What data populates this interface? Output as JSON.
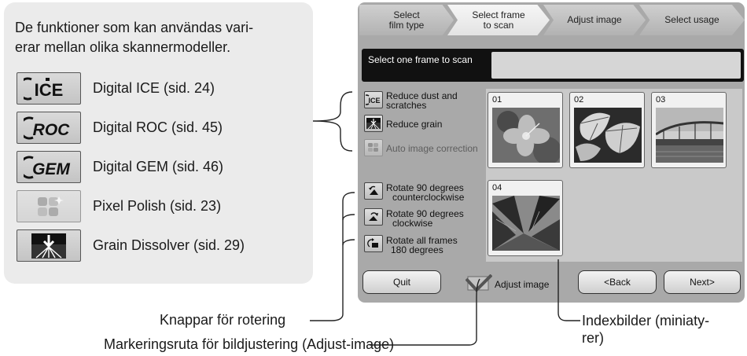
{
  "info_panel": {
    "intro": "De funktioner som kan användas vari-erar mellan olika skannermodeller.",
    "intro_line1": "De funktioner som kan användas vari-",
    "intro_line2": "erar mellan olika skannermodeller.",
    "features": [
      {
        "icon": "ice-icon",
        "icon_text": "ICE",
        "label": "Digital ICE (sid. 24)"
      },
      {
        "icon": "roc-icon",
        "icon_text": "ROC",
        "label": "Digital ROC (sid. 45)"
      },
      {
        "icon": "gem-icon",
        "icon_text": "GEM",
        "label": "Digital GEM (sid. 46)"
      },
      {
        "icon": "pixel-polish-icon",
        "label": "Pixel Polish (sid. 23)"
      },
      {
        "icon": "grain-dissolver-icon",
        "label": "Grain Dissolver (sid. 29)"
      }
    ]
  },
  "wizard": {
    "steps": [
      {
        "line1": "Select",
        "line2": "film type",
        "active": false
      },
      {
        "line1": "Select frame",
        "line2": "to scan",
        "active": true
      },
      {
        "line1": "Adjust image",
        "line2": "",
        "active": false
      },
      {
        "line1": "Select usage",
        "line2": "",
        "active": false
      }
    ],
    "prompt": "Select one frame to scan",
    "correction_tools": [
      {
        "icon": "ice-icon",
        "icon_text": "ICE",
        "line1": "Reduce dust and",
        "line2": "scratches",
        "enabled": true
      },
      {
        "icon": "grain-dissolver-icon",
        "line1": "Reduce grain",
        "line2": "",
        "enabled": true
      },
      {
        "icon": "auto-correction-icon",
        "line1": "Auto image correction",
        "line2": "",
        "enabled": false
      }
    ],
    "rotate_tools": [
      {
        "icon": "rotate-ccw-icon",
        "line1": "Rotate 90 degrees",
        "line2": "counterclockwise"
      },
      {
        "icon": "rotate-cw-icon",
        "line1": "Rotate 90 degrees",
        "line2": "clockwise"
      },
      {
        "icon": "rotate-180-icon",
        "line1": "Rotate all frames",
        "line2": "180 degrees"
      }
    ],
    "frames": [
      {
        "number": "01",
        "subject": "flower"
      },
      {
        "number": "02",
        "subject": "leaves"
      },
      {
        "number": "03",
        "subject": "bridge"
      },
      {
        "number": "04",
        "subject": "skyscrapers"
      }
    ],
    "buttons": {
      "quit": "Quit",
      "back": "<Back",
      "next": "Next>"
    },
    "adjust_image_checkbox": {
      "label": "Adjust image",
      "checked": true
    }
  },
  "callouts": {
    "rotation_buttons": "Knappar för rotering",
    "adjust_checkbox": "Markeringsruta för bildjustering (Adjust-image)",
    "thumbnails_line1": "Indexbilder (miniaty-",
    "thumbnails_line2": "rer)"
  },
  "colors": {
    "panel_bg": "#ebebeb",
    "window_bg": "#a9a9a9",
    "prompt_bar": "#111111",
    "thumb_area": "#c9c9c9"
  }
}
